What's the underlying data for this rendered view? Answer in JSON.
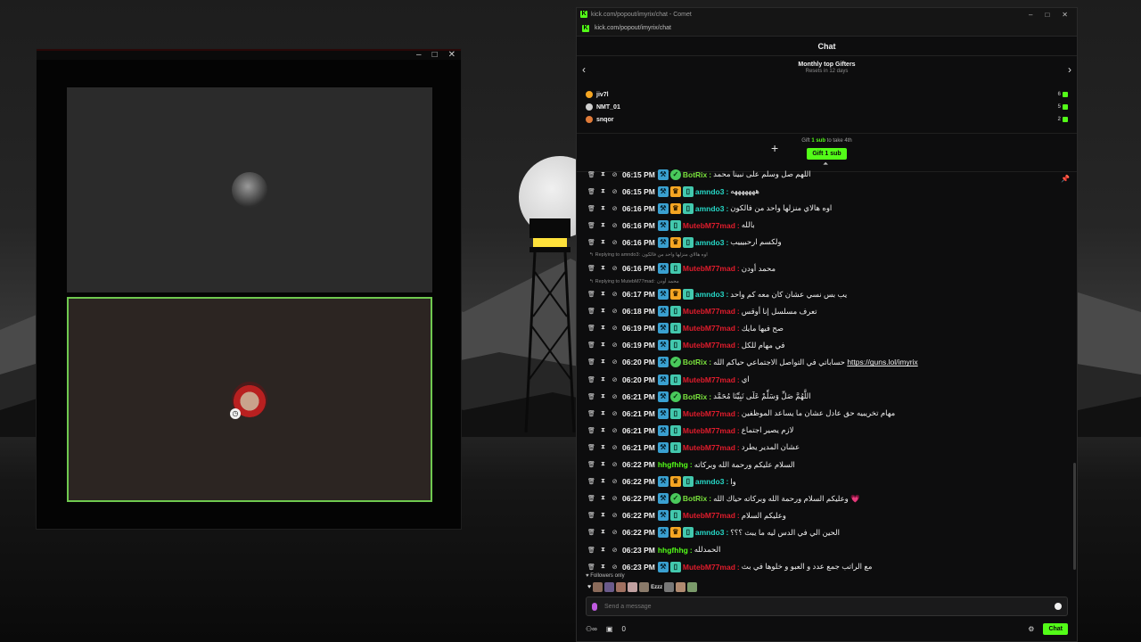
{
  "colors": {
    "accent": "#53fc18",
    "mod_cyan": "#26d7c6",
    "user_red": "#e01c2c",
    "tile_border": "#6fc94f"
  },
  "browser": {
    "title": "kick.com/popout/imyrix/chat - Comet",
    "url": "kick.com/popout/imyrix/chat"
  },
  "chat": {
    "header": "Chat",
    "gifters": {
      "title": "Monthly top Gifters",
      "subtitle": "Resets in 12 days",
      "list": [
        {
          "name": "jiv7l",
          "count": "6",
          "color": "#f5a623"
        },
        {
          "name": "NMT_01",
          "count": "5",
          "color": "#d0d0d0"
        },
        {
          "name": "snqor",
          "count": "2",
          "color": "#e07b39"
        }
      ],
      "gift_prompt_pre": "Gift",
      "gift_prompt_bold": "1 sub",
      "gift_prompt_post": "to take 4th",
      "gift_button": "Gift 1 sub"
    },
    "messages": [
      {
        "time": "06:15 PM",
        "user": "BotRix",
        "color": "lime",
        "badges": [
          "vip",
          "bot"
        ],
        "text": "اللهم صل وسلم على نبينا محمد"
      },
      {
        "time": "06:15 PM",
        "user": "amndo3",
        "color": "cyan",
        "badges": [
          "vip",
          "crown",
          "sub"
        ],
        "text": "هههههههه"
      },
      {
        "time": "06:16 PM",
        "user": "amndo3",
        "color": "cyan",
        "badges": [
          "vip",
          "crown",
          "sub"
        ],
        "text": "اوه هالاي منزلها واحد من فالكون"
      },
      {
        "time": "06:16 PM",
        "user": "MutebM77mad",
        "color": "red",
        "badges": [
          "vip",
          "sub"
        ],
        "text": "بالله"
      },
      {
        "time": "06:16 PM",
        "user": "amndo3",
        "color": "cyan",
        "badges": [
          "vip",
          "crown",
          "sub"
        ],
        "text": "ولكسم ارحبيييب"
      },
      {
        "reply": "Replying to amndo3:",
        "reply_text": "اوه هالاي منزلها واحد من فالكون"
      },
      {
        "time": "06:16 PM",
        "user": "MutebM77mad",
        "color": "red",
        "badges": [
          "vip",
          "sub"
        ],
        "text": "محمد أودن"
      },
      {
        "reply": "Replying to MutebM77mad:",
        "reply_text": "محمد أودن"
      },
      {
        "time": "06:17 PM",
        "user": "amndo3",
        "color": "cyan",
        "badges": [
          "vip",
          "crown",
          "sub"
        ],
        "text": "يب بس نسي عشان كان معه كم واحد"
      },
      {
        "time": "06:18 PM",
        "user": "MutebM77mad",
        "color": "red",
        "badges": [
          "vip",
          "sub"
        ],
        "text": "تعرف مسلسل إنا أوقس"
      },
      {
        "time": "06:19 PM",
        "user": "MutebM77mad",
        "color": "red",
        "badges": [
          "vip",
          "sub"
        ],
        "text": "صح فيها مايك"
      },
      {
        "time": "06:19 PM",
        "user": "MutebM77mad",
        "color": "red",
        "badges": [
          "vip",
          "sub"
        ],
        "text": "في مهام للكل"
      },
      {
        "time": "06:20 PM",
        "user": "BotRix",
        "color": "lime",
        "badges": [
          "vip",
          "bot"
        ],
        "text": "حساباتي في التواصل الاجتماعي حياكم الله",
        "link": "https://guns.lol/imyrix"
      },
      {
        "time": "06:20 PM",
        "user": "MutebM77mad",
        "color": "red",
        "badges": [
          "vip",
          "sub"
        ],
        "text": "اي"
      },
      {
        "time": "06:21 PM",
        "user": "BotRix",
        "color": "lime",
        "badges": [
          "vip",
          "bot"
        ],
        "text": "اللَّهُمَّ صَلِّ وَسَلِّمْ عَلَى نَبِيِّنَا مُحَمَّد"
      },
      {
        "time": "06:21 PM",
        "user": "MutebM77mad",
        "color": "red",
        "badges": [
          "vip",
          "sub"
        ],
        "text": "مهام تخريبيه حق عادل عشان ما يساعد الموظفين"
      },
      {
        "time": "06:21 PM",
        "user": "MutebM77mad",
        "color": "red",
        "badges": [
          "vip",
          "sub"
        ],
        "text": "لازم يصير اجتماع"
      },
      {
        "time": "06:21 PM",
        "user": "MutebM77mad",
        "color": "red",
        "badges": [
          "vip",
          "sub"
        ],
        "text": "عشان المدير يطرد"
      },
      {
        "time": "06:22 PM",
        "user": "hhgfhhg",
        "color": "green",
        "badges": [],
        "text": "السلام عليكم ورحمة الله وبركاته"
      },
      {
        "time": "06:22 PM",
        "user": "amndo3",
        "color": "cyan",
        "badges": [
          "vip",
          "crown",
          "sub"
        ],
        "text": "وا"
      },
      {
        "time": "06:22 PM",
        "user": "BotRix",
        "color": "lime",
        "badges": [
          "vip",
          "bot"
        ],
        "text": "وعليكم السلام ورحمة الله وبركاته حياك الله 💗"
      },
      {
        "time": "06:22 PM",
        "user": "MutebM77mad",
        "color": "red",
        "badges": [
          "vip",
          "sub"
        ],
        "text": "وعليكم السلام"
      },
      {
        "time": "06:22 PM",
        "user": "amndo3",
        "color": "cyan",
        "badges": [
          "vip",
          "crown",
          "sub"
        ],
        "text": "الحين الي في الدس ليه ما يبث ؟؟؟"
      },
      {
        "time": "06:23 PM",
        "user": "hhgfhhg",
        "color": "green",
        "badges": [],
        "text": "الحمدلله"
      },
      {
        "time": "06:23 PM",
        "user": "MutebM77mad",
        "color": "red",
        "badges": [
          "vip",
          "sub"
        ],
        "text": "مع الراتب جمع عدد و العبو و خلوها في بث"
      }
    ],
    "followers_only": "Followers only",
    "emote_word": "Ezzz",
    "input_placeholder": "Send a message",
    "viewer_count": "0",
    "chat_button": "Chat"
  }
}
